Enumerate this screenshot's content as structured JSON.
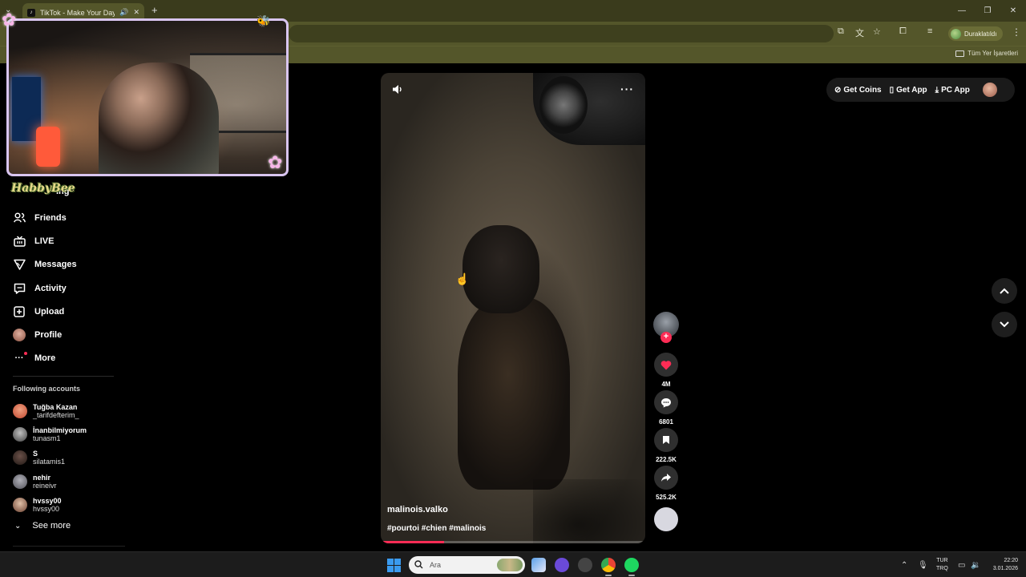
{
  "browser": {
    "tab_title": "TikTok - Make Your Day",
    "profile_status": "Duraklatıldı",
    "bookmarks_all": "Tüm Yer İşaretleri"
  },
  "overlay": {
    "sticker_text": "HabbyBee"
  },
  "sidebar": {
    "partial_item": "ing",
    "items": [
      {
        "label": "Friends",
        "icon": "friends-icon"
      },
      {
        "label": "LIVE",
        "icon": "live-icon"
      },
      {
        "label": "Messages",
        "icon": "messages-icon"
      },
      {
        "label": "Activity",
        "icon": "activity-icon"
      },
      {
        "label": "Upload",
        "icon": "upload-icon"
      },
      {
        "label": "Profile",
        "icon": "profile-avatar"
      },
      {
        "label": "More",
        "icon": "more-icon"
      }
    ],
    "following_title": "Following accounts",
    "following": [
      {
        "name": "Tuğba Kazan",
        "handle": "_tarifdefterim_"
      },
      {
        "name": "İnanbilmiyorum",
        "handle": "tunasm1"
      },
      {
        "name": "S",
        "handle": "silatamis1"
      },
      {
        "name": "nehir",
        "handle": "reineivr"
      },
      {
        "name": "hvssy00",
        "handle": "hvssy00"
      }
    ],
    "see_more": "See more"
  },
  "video": {
    "author": "malinois.valko",
    "tags": "#pourtoi #chien #malinois",
    "progress": 0.24
  },
  "actions": {
    "likes": "4M",
    "comments": "6801",
    "saves": "222.5K",
    "shares": "525.2K"
  },
  "topbar": {
    "get_coins": "Get Coins",
    "get_app": "Get App",
    "pc_app": "PC App"
  },
  "taskbar": {
    "search_placeholder": "Ara",
    "lang_1": "TUR",
    "lang_2": "TRQ",
    "time": "22:20",
    "date": "3.01.2026"
  },
  "colors": {
    "accent": "#fe2c55",
    "browser_frame": "#54562a"
  }
}
